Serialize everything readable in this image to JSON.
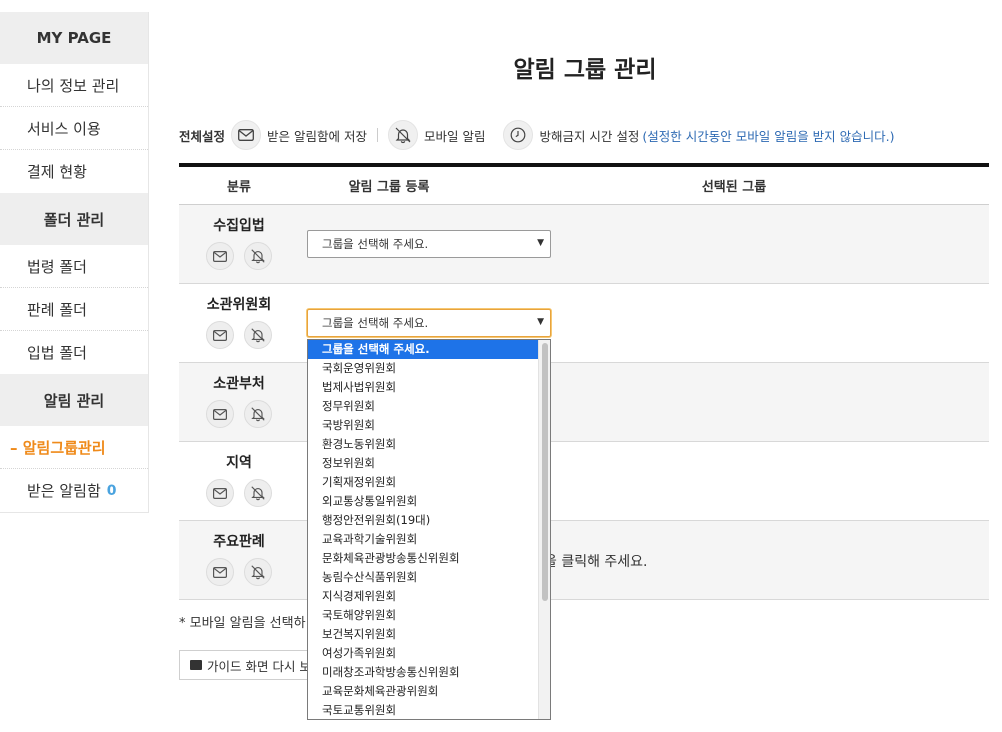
{
  "sidebar": {
    "sections": [
      {
        "title": "MY PAGE",
        "items": [
          "나의 정보 관리",
          "서비스 이용",
          "결제 현황"
        ]
      },
      {
        "title": "폴더 관리",
        "items": [
          "법령 폴더",
          "판례 폴더",
          "입법 폴더"
        ]
      },
      {
        "title": "알림 관리",
        "items": [
          "– 알림그룹관리",
          "받은 알림함"
        ]
      }
    ],
    "inbox_count": "0"
  },
  "page_title": "알림 그룹 관리",
  "settings": {
    "all_label": "전체설정",
    "save_label": "받은 알림함에 저장",
    "mobile_label": "모바일 알림",
    "dnd_label": "방해금지 시간 설정",
    "dnd_note": "(설정한 시간동안 모바일 알림을 받지 않습니다.)"
  },
  "table": {
    "headers": [
      "분류",
      "알림 그룹 등록",
      "선택된 그룹"
    ],
    "rows": [
      {
        "category": "수집입법",
        "select_value": "그룹을 선택해 주세요."
      },
      {
        "category": "소관위원회",
        "select_value": "그룹을 선택해 주세요."
      },
      {
        "category": "소관부처",
        "select_value": ""
      },
      {
        "category": "지역",
        "select_value": ""
      },
      {
        "category": "주요판례",
        "select_value": "",
        "selected_text": "을 클릭해 주세요."
      }
    ]
  },
  "footnote": "* 모바일 알림을 선택하",
  "guide_button": "가이드 화면 다시 보",
  "dropdown": {
    "options": [
      "그룹을 선택해 주세요.",
      "국회운영위원회",
      "법제사법위원회",
      "정무위원회",
      "국방위원회",
      "환경노동위원회",
      "정보위원회",
      "기획재정위원회",
      "외교통상통일위원회",
      "행정안전위원회(19대)",
      "교육과학기술위원회",
      "문화체육관광방송통신위원회",
      "농림수산식품위원회",
      "지식경제위원회",
      "국토해양위원회",
      "보건복지위원회",
      "여성가족위원회",
      "미래창조과학방송통신위원회",
      "교육문화체육관광위원회",
      "국토교통위원회"
    ],
    "highlighted_index": 0
  },
  "colors": {
    "accent": "#ef8a1a",
    "link": "#2e6ab3",
    "highlight": "#1e73e8",
    "count": "#4aa3df"
  }
}
